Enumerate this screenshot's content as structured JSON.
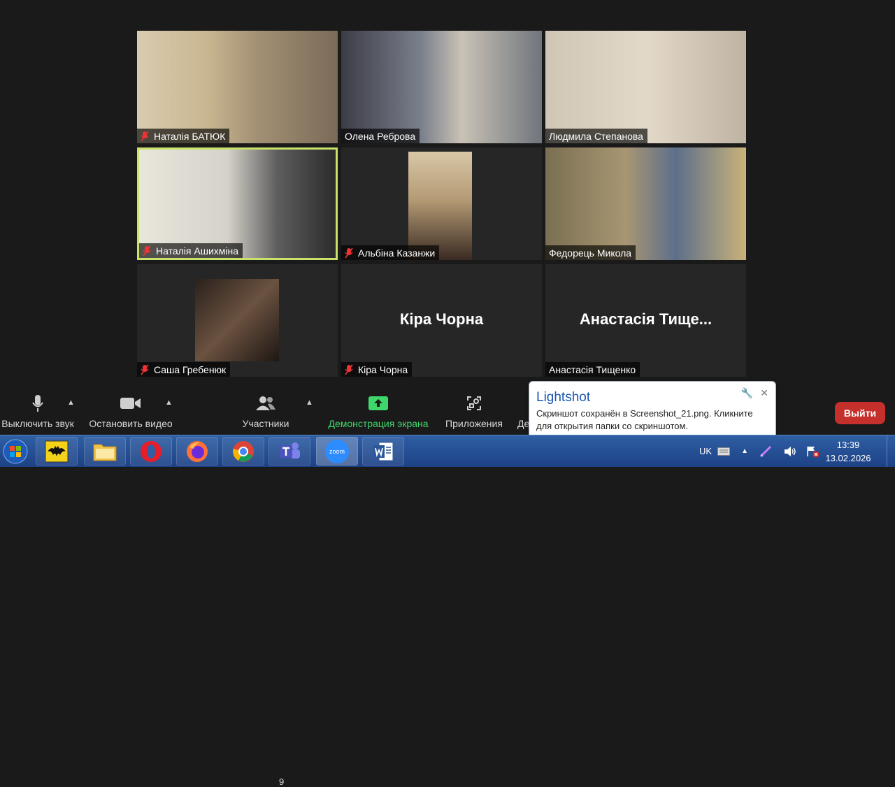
{
  "participants": [
    {
      "name": "Наталія БАТЮК",
      "muted": true,
      "video": true
    },
    {
      "name": "Олена Реброва",
      "muted": false,
      "video": true
    },
    {
      "name": "Людмила Степанова",
      "muted": false,
      "video": true
    },
    {
      "name": "Наталія Ашихміна",
      "muted": true,
      "video": true,
      "active_speaker": true
    },
    {
      "name": "Альбіна Казанжи",
      "muted": true,
      "video": true
    },
    {
      "name": "Федорець Микола",
      "muted": false,
      "video": true
    },
    {
      "name": "Саша Гребенюк",
      "muted": true,
      "video": true
    },
    {
      "name": "Кіра Чорна",
      "muted": true,
      "video": false,
      "display_name": "Кіра Чорна"
    },
    {
      "name": "Анастасія Тищенко",
      "muted": false,
      "video": false,
      "display_name": "Анастасія Тище..."
    }
  ],
  "toolbar": {
    "mute_label": "Выключить звук",
    "video_label": "Остановить видео",
    "participants_label": "Участники",
    "participants_count": "9",
    "share_label": "Демонстрация экрана",
    "apps_label": "Приложения",
    "more_label": "Де",
    "leave_label": "Выйти"
  },
  "notification": {
    "title": "Lightshot",
    "body": "Скриншот сохранён в Screenshot_21.png. Кликните для открытия папки со скриншотом."
  },
  "taskbar": {
    "apps": [
      "start-orb",
      "batman-app",
      "file-explorer",
      "opera",
      "firefox",
      "chrome",
      "teams",
      "zoom",
      "word"
    ],
    "zoom_label": "zoom",
    "lang": "UK",
    "time": "13:39",
    "date": "13.02.2026"
  },
  "colors": {
    "active_speaker_border": "#c9e26a",
    "share_green": "#3fd66b",
    "leave_red": "#c5302c",
    "lightshot_title": "#1a56b3"
  }
}
